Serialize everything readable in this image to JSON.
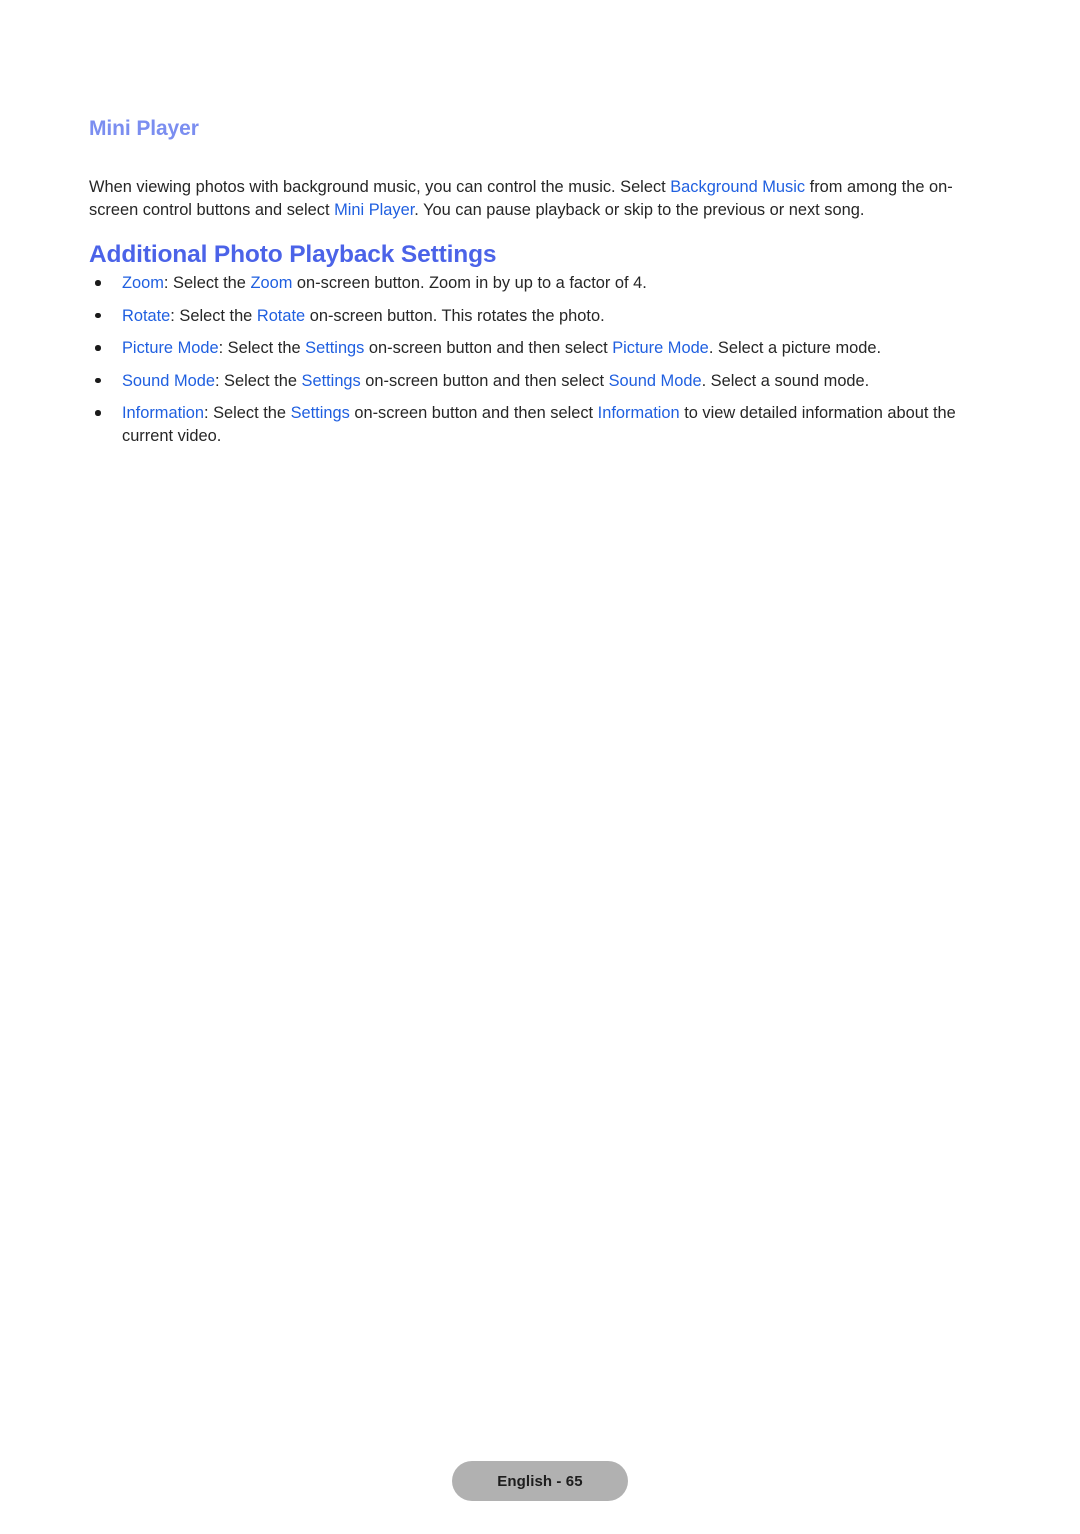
{
  "document": {
    "sub_heading": "Mini Player",
    "main_heading": "Additional Photo Playback Settings",
    "intro": {
      "part1": "When viewing photos with background music, you can control the music. Select ",
      "link1": "Background Music",
      "part2": " from among the on-screen control buttons and select ",
      "link2": "Mini Player",
      "part3": ". You can pause playback or skip to the previous or next song."
    },
    "bullets": [
      {
        "term": "Zoom",
        "part1": ": Select the ",
        "link1": "Zoom",
        "part2": " on-screen button. Zoom in by up to a factor of 4.",
        "link2": "",
        "part3": ""
      },
      {
        "term": "Rotate",
        "part1": ": Select the ",
        "link1": "Rotate",
        "part2": " on-screen button. This rotates the photo.",
        "link2": "",
        "part3": ""
      },
      {
        "term": "Picture Mode",
        "part1": ": Select the ",
        "link1": "Settings",
        "part2": " on-screen button and then select ",
        "link2": "Picture Mode",
        "part3": ". Select a picture mode."
      },
      {
        "term": "Sound Mode",
        "part1": ": Select the ",
        "link1": "Settings",
        "part2": " on-screen button and then select ",
        "link2": "Sound Mode",
        "part3": ". Select a sound mode."
      },
      {
        "term": "Information",
        "part1": ": Select the ",
        "link1": "Settings",
        "part2": " on-screen button and then select ",
        "link2": "Information",
        "part3": " to view detailed information about the current video."
      }
    ],
    "footer": {
      "page_label": "English - 65"
    },
    "colors": {
      "sub_heading": "#7b8ef0",
      "main_heading": "#4b63e8",
      "link": "#1f5fe0",
      "body_text": "#262626",
      "footer_pill": "#b1b1b1"
    }
  }
}
